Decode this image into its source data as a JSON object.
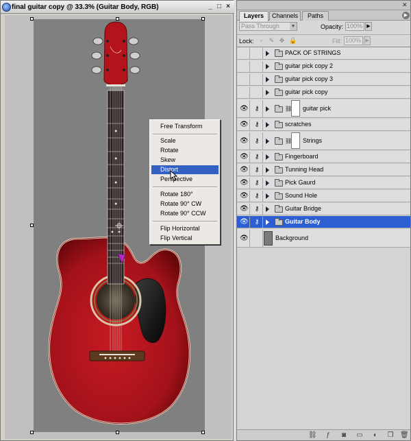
{
  "document": {
    "title": "final guitar copy @ 33.3% (Guitar Body, RGB)",
    "window_buttons": [
      "_",
      "□",
      "×"
    ]
  },
  "context_menu": {
    "groups": [
      [
        "Free Transform"
      ],
      [
        "Scale",
        "Rotate",
        "Skew",
        "Distort",
        "Perspective"
      ],
      [
        "Rotate 180°",
        "Rotate 90° CW",
        "Rotate 90° CCW"
      ],
      [
        "Flip Horizontal",
        "Flip Vertical"
      ]
    ],
    "highlighted": "Distort"
  },
  "layers_panel": {
    "tabs": [
      "Layers",
      "Channels",
      "Paths"
    ],
    "active_tab": "Layers",
    "blend_mode": "Pass Through",
    "opacity_label": "Opacity:",
    "opacity": "100%",
    "lock_label": "Lock:",
    "fill_label": "Fill:",
    "fill": "100%",
    "layers": [
      {
        "name": "PACK OF STRINGS",
        "visible": false,
        "type": "group"
      },
      {
        "name": "guitar pick copy 2",
        "visible": false,
        "type": "group"
      },
      {
        "name": "guitar pick copy 3",
        "visible": false,
        "type": "group"
      },
      {
        "name": "guitar pick copy",
        "visible": false,
        "type": "group"
      },
      {
        "name": "guitar pick",
        "visible": true,
        "type": "group-mask"
      },
      {
        "name": "scratches",
        "visible": true,
        "type": "group"
      },
      {
        "name": "Strings",
        "visible": true,
        "type": "group-mask"
      },
      {
        "name": "Fingerboard",
        "visible": true,
        "type": "group"
      },
      {
        "name": "Tunning Head",
        "visible": true,
        "type": "group"
      },
      {
        "name": "Pick Gaurd",
        "visible": true,
        "type": "group"
      },
      {
        "name": "Sound Hole",
        "visible": true,
        "type": "group"
      },
      {
        "name": "Guitar Bridge",
        "visible": true,
        "type": "group"
      },
      {
        "name": "Guitar Body",
        "visible": true,
        "type": "group",
        "selected": true
      },
      {
        "name": "Background",
        "visible": true,
        "type": "background"
      }
    ],
    "bottom_icons": [
      "link-layers-icon",
      "layer-style-icon",
      "add-mask-icon",
      "new-group-icon",
      "adjustment-layer-icon",
      "new-layer-icon",
      "trash-icon"
    ]
  },
  "colors": {
    "selection": "#2d5fd2",
    "guitar_body": "#b0141b",
    "canvas": "#808080"
  }
}
